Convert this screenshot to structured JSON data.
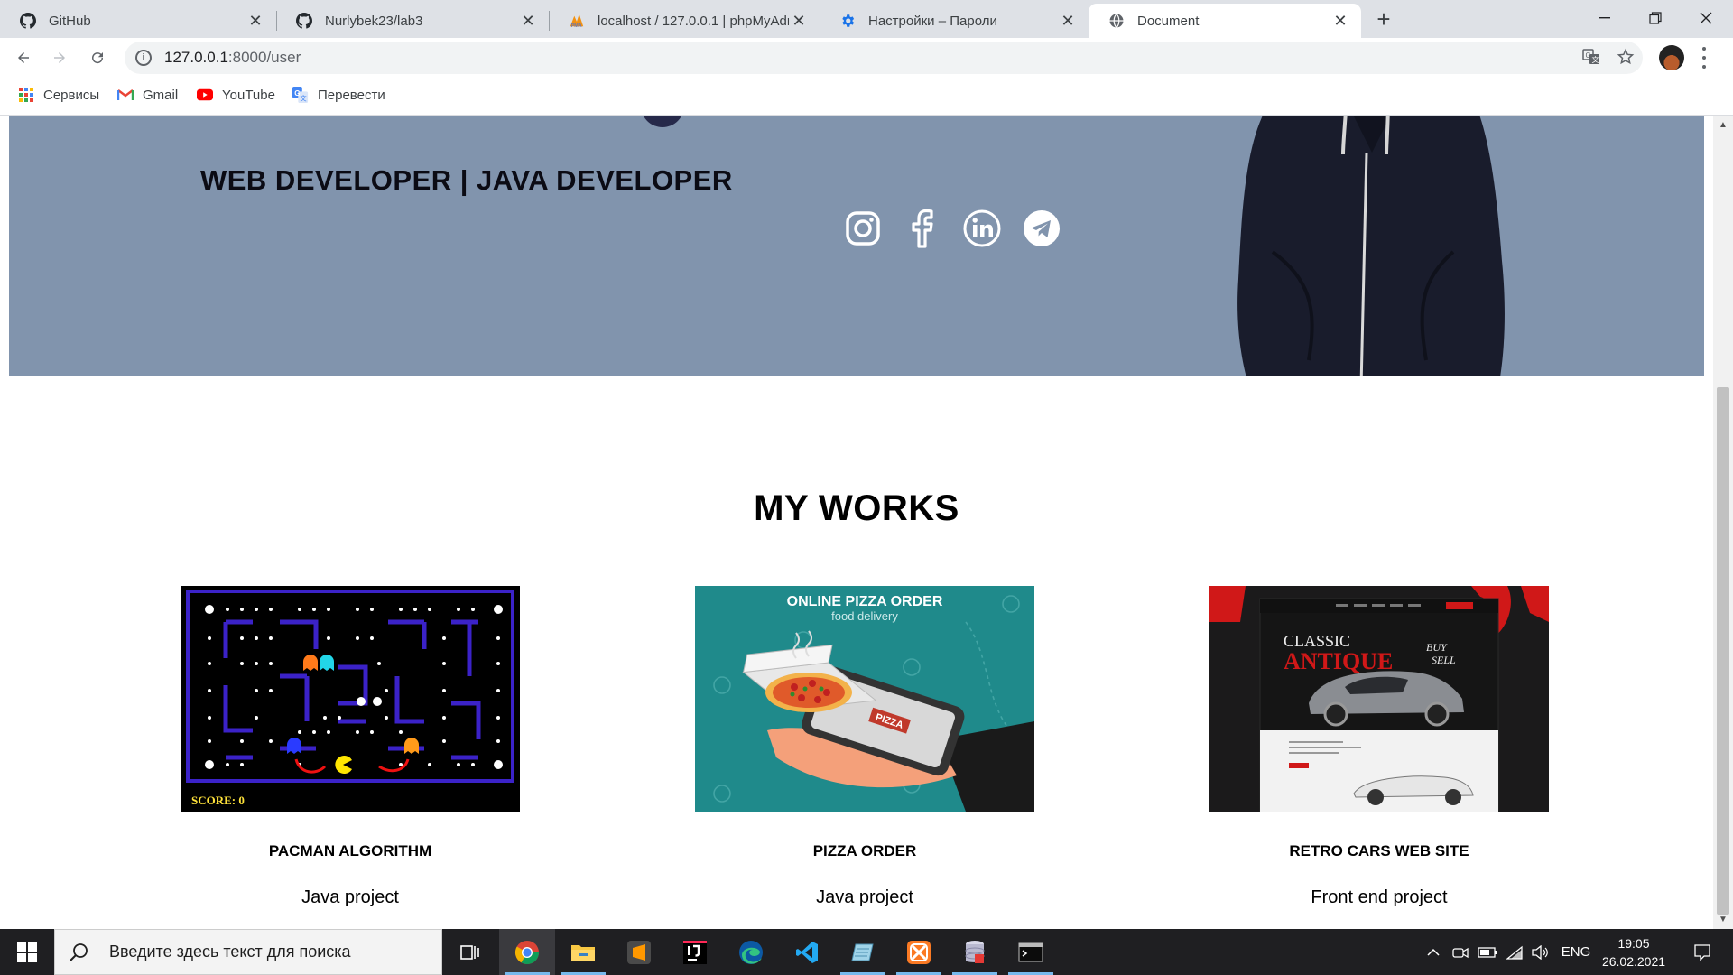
{
  "browser": {
    "tabs": [
      {
        "title": "GitHub",
        "icon": "github-icon",
        "active": false
      },
      {
        "title": "Nurlybek23/lab3",
        "icon": "github-icon",
        "active": false
      },
      {
        "title": "localhost / 127.0.0.1 | phpMyAdm",
        "icon": "phpmyadmin-icon",
        "active": false
      },
      {
        "title": "Настройки – Пароли",
        "icon": "settings-gear-icon",
        "active": false
      },
      {
        "title": "Document",
        "icon": "globe-icon",
        "active": true
      }
    ],
    "address": {
      "host": "127.0.0.1",
      "path": ":8000/user"
    },
    "bookmarks": [
      {
        "label": "Сервисы",
        "icon": "apps-grid-icon"
      },
      {
        "label": "Gmail",
        "icon": "gmail-icon"
      },
      {
        "label": "YouTube",
        "icon": "youtube-icon"
      },
      {
        "label": "Перевести",
        "icon": "google-translate-icon"
      }
    ]
  },
  "page": {
    "hero": {
      "role": "WEB DEVELOPER | JAVA DEVELOPER",
      "socials": [
        "instagram-icon",
        "facebook-icon",
        "linkedin-icon",
        "telegram-icon"
      ],
      "background": "#8194ad"
    },
    "works": {
      "title": "MY WORKS",
      "items": [
        {
          "name": "PACMAN ALGORITHM",
          "type": "Java project",
          "image": "pacman-screenshot"
        },
        {
          "name": "PIZZA ORDER",
          "type": "Java project",
          "image": "pizza-order-illustration",
          "image_text": {
            "heading": "ONLINE PIZZA ORDER",
            "sub": "food delivery",
            "sign": "PIZZA"
          }
        },
        {
          "name": "RETRO CARS WEB SITE",
          "type": "Front end project",
          "image": "retro-cars-screenshot",
          "image_text": {
            "classic": "CLASSIC",
            "antique": "ANTIQUE",
            "buy": "BUY",
            "sell": "SELL"
          }
        }
      ],
      "pacman_score": "SCORE:   0"
    }
  },
  "taskbar": {
    "search_placeholder": "Введите здесь текст для поиска",
    "apps": [
      "task-view-icon",
      "chrome-icon",
      "file-explorer-icon",
      "sublime-text-icon",
      "intellij-icon",
      "edge-icon",
      "vscode-icon",
      "notepad-icon",
      "xampp-icon",
      "database-icon",
      "terminal-icon"
    ],
    "language": "ENG",
    "time": "19:05",
    "date": "26.02.2021"
  }
}
